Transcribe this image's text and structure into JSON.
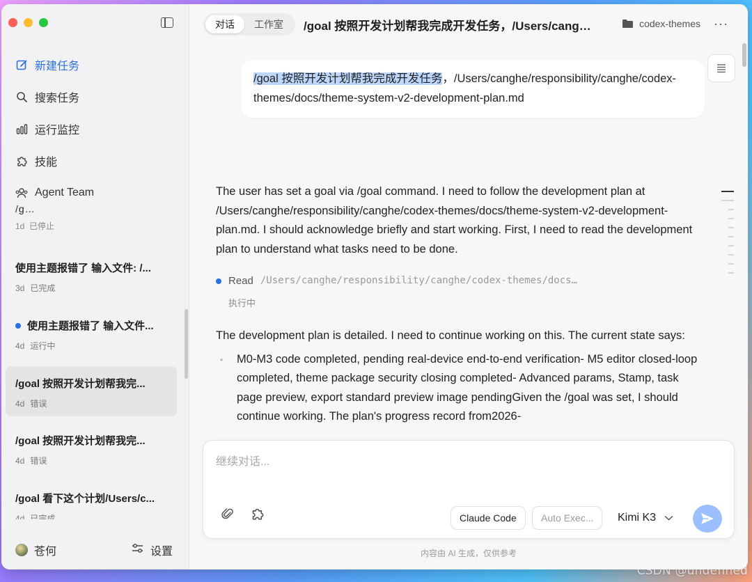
{
  "sidebar": {
    "nav": [
      {
        "label": "新建任务",
        "icon": "new-task-icon"
      },
      {
        "label": "搜索任务",
        "icon": "search-icon"
      },
      {
        "label": "运行监控",
        "icon": "chart-bars-icon"
      },
      {
        "label": "技能",
        "icon": "puzzle-icon"
      },
      {
        "label": "Agent Team",
        "icon": "team-icon"
      }
    ],
    "partial_task": {
      "title": "/g…",
      "age": "1d",
      "status": "已停止"
    },
    "tasks": [
      {
        "title": "使用主题报错了 输入文件: /...",
        "age": "3d",
        "status": "已完成",
        "running": false,
        "active": false
      },
      {
        "title": "使用主题报错了 输入文件...",
        "age": "4d",
        "status": "运行中",
        "running": true,
        "active": false
      },
      {
        "title": "/goal 按照开发计划帮我完...",
        "age": "4d",
        "status": "错误",
        "running": false,
        "active": true
      },
      {
        "title": "/goal 按照开发计划帮我完...",
        "age": "4d",
        "status": "错误",
        "running": false,
        "active": false
      },
      {
        "title": "/goal 看下这个计划/Users/c...",
        "age": "4d",
        "status": "已完成",
        "running": false,
        "active": false
      }
    ],
    "user_name": "苍何",
    "settings_label": "设置"
  },
  "topbar": {
    "tabs": [
      "对话",
      "工作室"
    ],
    "title": "/goal 按照开发计划帮我完成开发任务，/Users/canghe...",
    "folder": "codex-themes",
    "more": "···"
  },
  "conversation": {
    "user_message": {
      "highlighted": "/goal 按照开发计划帮我完成开发任务",
      "rest": "，/Users/canghe/responsibility/canghe/codex-themes/docs/theme-system-v2-development-plan.md"
    },
    "assistant_p1": "The user has set a goal via /goal command. I need to follow the development plan at /Users/canghe/responsibility/canghe/codex-themes/docs/theme-system-v2-development-plan.md. I should acknowledge briefly and start working. First, I need to read the development plan to understand what tasks need to be done.",
    "tool": {
      "label": "Read",
      "path": "/Users/canghe/responsibility/canghe/codex-themes/docs/…",
      "status": "执行中"
    },
    "assistant_p2": "The development plan is detailed. I need to continue working on this. The current state says:",
    "bullet": "M0-M3 code completed, pending real-device end-to-end verification- M5 editor closed-loop completed, theme package security closing completed- Advanced params, Stamp, task page preview, export standard preview image pendingGiven the /goal was set, I should continue working. The plan's progress record from2026-"
  },
  "composer": {
    "placeholder": "继续对话...",
    "agent_chip": "Claude Code",
    "mode_chip": "Auto Exec...",
    "model": "Kimi K3"
  },
  "footer": {
    "disclaimer": "内容由 AI 生成，仅供参考"
  },
  "watermark": "CSDN @undefined",
  "colors": {
    "accent": "#2d6fe0",
    "highlight": "#bcd7fb",
    "send_button": "#9cc0ff",
    "traffic_red": "#fe5f57",
    "traffic_yellow": "#febc2e",
    "traffic_green": "#28c840"
  }
}
